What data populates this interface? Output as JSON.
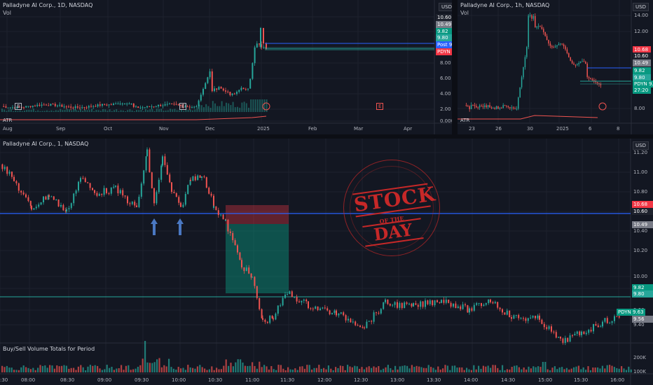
{
  "colors": {
    "up": "#26a69a",
    "down": "#ef5350",
    "bg": "#131722",
    "grid": "#1e222d",
    "blue": "#2962ff",
    "stamp": "#c62828"
  },
  "pane1": {
    "title": "Palladyne AI Corp., 1D, NASDAQ",
    "vol": "Vol",
    "atr": "ATR",
    "currency": "USD",
    "yticks": [
      "14.00",
      "12.00",
      "10.00",
      "8.00",
      "6.00",
      "4.00",
      "2.00",
      "0.0000"
    ],
    "xticks": [
      "Aug",
      "Sep",
      "Oct",
      "Nov",
      "Dec",
      "2025",
      "Feb",
      "Mar",
      "Apr"
    ],
    "price_tags": [
      {
        "label": "",
        "value": "10.60",
        "color": "#1e222d"
      },
      {
        "label": "",
        "value": "10.49",
        "color": "#787b86"
      },
      {
        "label": "",
        "value": "9.82",
        "color": "#089981"
      },
      {
        "label": "",
        "value": "9.80",
        "color": "#26a69a"
      },
      {
        "label": "Post",
        "value": "9.63",
        "color": "#2962ff"
      },
      {
        "label": "PDYN",
        "value": "9.57",
        "color": "#f23645"
      }
    ],
    "markers": [
      "E",
      "E",
      "E"
    ]
  },
  "pane2": {
    "title": "Palladyne AI Corp., 1h, NASDAQ",
    "vol": "Vol",
    "atr": "ATR",
    "currency": "USD",
    "yticks": [
      "14.00",
      "12.00",
      "8.00"
    ],
    "xticks": [
      "23",
      "26",
      "30",
      "2025",
      "6",
      "8"
    ],
    "price_tags": [
      {
        "label": "",
        "value": "10.68",
        "color": "#f23645"
      },
      {
        "label": "",
        "value": "10.60",
        "color": "#1e222d"
      },
      {
        "label": "",
        "value": "10.49",
        "color": "#787b86"
      },
      {
        "label": "",
        "value": "9.82",
        "color": "#089981"
      },
      {
        "label": "",
        "value": "9.80",
        "color": "#26a69a"
      },
      {
        "label": "PDYN",
        "value": "9.63",
        "color": "#089981"
      },
      {
        "label": "",
        "value": "27:20",
        "color": "#089981"
      }
    ]
  },
  "pane3": {
    "title": "Palladyne AI Corp., 1, NASDAQ",
    "currency": "USD",
    "yticks": [
      "11.20",
      "11.00",
      "10.80",
      "10.60",
      "10.40",
      "10.20",
      "10.00",
      "9.80",
      "9.60",
      "9.40",
      "200K",
      "100K"
    ],
    "xticks": [
      ":30",
      "08:00",
      "08:30",
      "09:00",
      "09:30",
      "10:00",
      "10:30",
      "11:00",
      "11:30",
      "12:00",
      "12:30",
      "13:00",
      "13:30",
      "14:00",
      "14:30",
      "15:00",
      "15:30",
      "16:00"
    ],
    "price_tags": [
      {
        "label": "",
        "value": "10.68",
        "color": "#f23645"
      },
      {
        "label": "",
        "value": "10.60",
        "color": "#1e222d"
      },
      {
        "label": "",
        "value": "10.49",
        "color": "#787b86"
      },
      {
        "label": "",
        "value": "9.82",
        "color": "#089981"
      },
      {
        "label": "",
        "value": "9.80",
        "color": "#26a69a"
      },
      {
        "label": "PDYN",
        "value": "9.63",
        "color": "#089981"
      },
      {
        "label": "",
        "value": "9.56",
        "color": "#787b86"
      }
    ],
    "volume_title": "Buy/Sell Volume Totals for Period",
    "stamp": {
      "line1": "STOCK",
      "line2": "OF THE",
      "line3": "DAY"
    }
  }
}
